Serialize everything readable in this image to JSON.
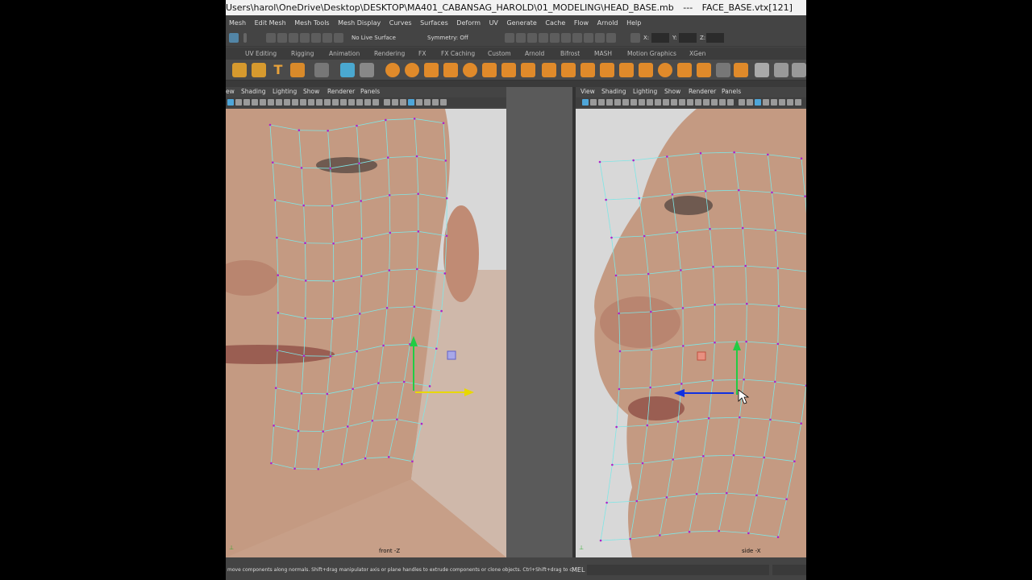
{
  "title": {
    "path": "Users\\harol\\OneDrive\\Desktop\\DESKTOP\\MA401_CABANSAG_HAROLD\\01_MODELING\\HEAD_BASE.mb",
    "separator": "---",
    "selection": "FACE_BASE.vtx[121]"
  },
  "menubar": [
    "Mesh",
    "Edit Mesh",
    "Mesh Tools",
    "Mesh Display",
    "Curves",
    "Surfaces",
    "Deform",
    "UV",
    "Generate",
    "Cache",
    "Flow",
    "Arnold",
    "Help"
  ],
  "status_line": {
    "live_surface": "No Live Surface",
    "symmetry": "Symmetry: Off",
    "x_label": "X:",
    "y_label": "Y:",
    "z_label": "Z:"
  },
  "shelf_tabs": [
    "UV Editing",
    "Rigging",
    "Animation",
    "Rendering",
    "FX",
    "FX Caching",
    "Custom",
    "Arnold",
    "Bifrost",
    "MASH",
    "Motion Graphics",
    "XGen"
  ],
  "shelf_icons": [
    "star-icon",
    "gear-icon",
    "text-icon",
    "svg-icon",
    "grid-icon",
    "hypershade-icon",
    "render-icon",
    "sphere-icon",
    "sphere-icon",
    "cube-icon",
    "cylinder-icon",
    "arrow-icon",
    "mesh-icon",
    "bevel-icon",
    "extrude-icon",
    "merge-icon",
    "bridge-icon",
    "edge-loop-icon",
    "pen-icon",
    "grid-icon"
  ],
  "left_panel": {
    "menus": [
      "ew",
      "Shading",
      "Lighting",
      "Show",
      "Renderer",
      "Panels"
    ],
    "camera_label": "front -Z"
  },
  "right_panel": {
    "menus": [
      "View",
      "Shading",
      "Lighting",
      "Show",
      "Renderer",
      "Panels"
    ],
    "camera_label": "side -X"
  },
  "help_line": {
    "text": "move components along normals. Shift+drag manipulator axis or plane handles to extrude components or clone objects. Ctrl+Shift+drag to c",
    "mel_label": "MEL"
  },
  "colors": {
    "wireframe": "#7fe6e6",
    "vertex": "#b020c8",
    "viewport_bg": "#d8d8d8",
    "skin": "#c49a82",
    "y_axis": "#22cc44",
    "x_axis": "#e8d800",
    "z_axis": "#1030e0"
  }
}
